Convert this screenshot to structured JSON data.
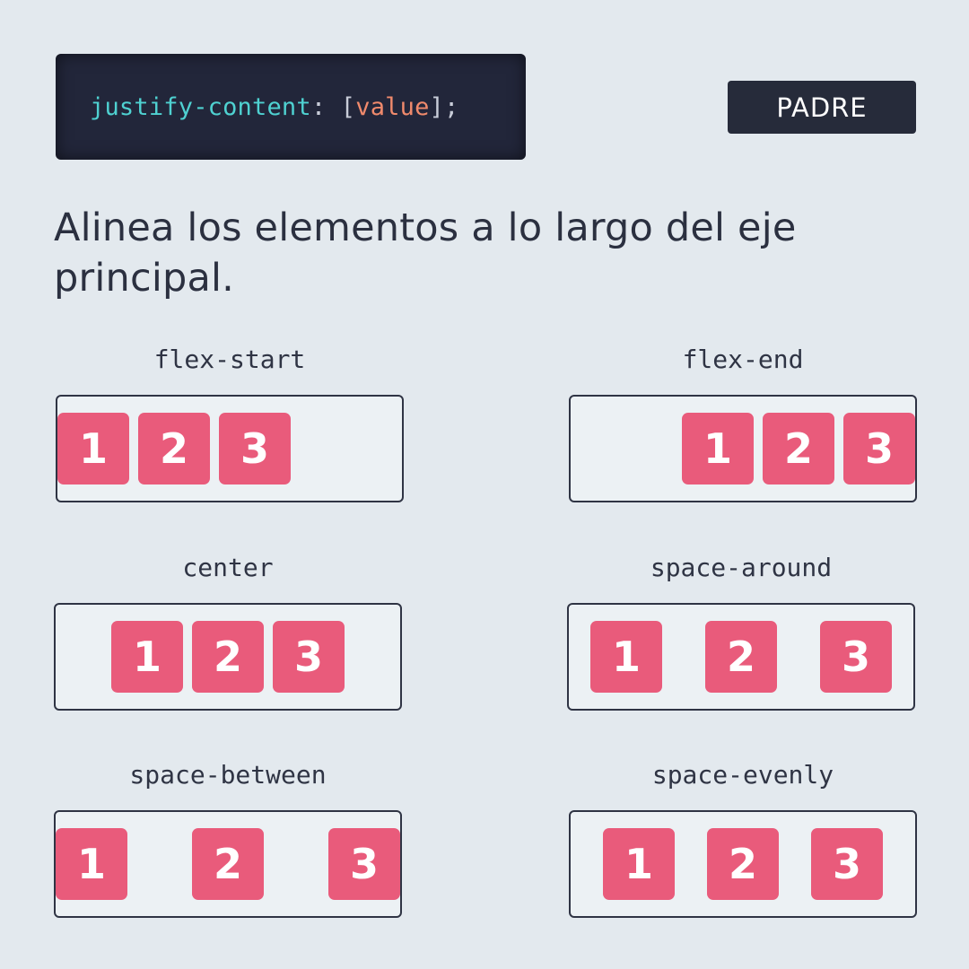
{
  "code": {
    "property": "justify-content",
    "colon": ":",
    "open_bracket": "[",
    "value": "value",
    "close": "];"
  },
  "badge": "PADRE",
  "description": "Alinea los elementos a lo largo del eje principal.",
  "colors": {
    "background": "#e3e9ee",
    "code_background": "#22263a",
    "property": "#4fd1d1",
    "value": "#f08a6c",
    "item": "#e95b7b",
    "badge": "#262b3a"
  },
  "examples": [
    {
      "label": "flex-start",
      "items": [
        "1",
        "2",
        "3"
      ]
    },
    {
      "label": "flex-end",
      "items": [
        "1",
        "2",
        "3"
      ]
    },
    {
      "label": "center",
      "items": [
        "1",
        "2",
        "3"
      ]
    },
    {
      "label": "space-around",
      "items": [
        "1",
        "2",
        "3"
      ]
    },
    {
      "label": "space-between",
      "items": [
        "1",
        "2",
        "3"
      ]
    },
    {
      "label": "space-evenly",
      "items": [
        "1",
        "2",
        "3"
      ]
    }
  ]
}
